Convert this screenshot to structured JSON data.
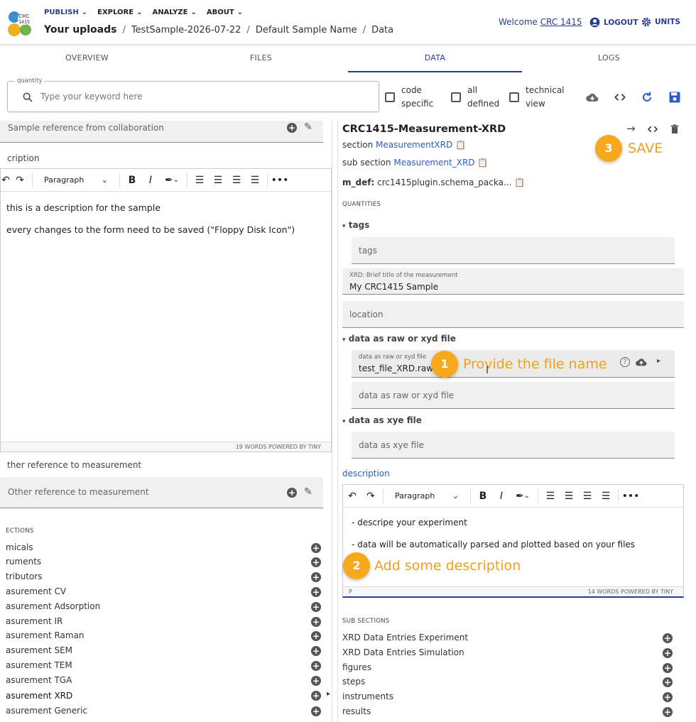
{
  "header": {
    "logo_text_top": "CRC",
    "logo_text_bottom": "1415",
    "nav": [
      "PUBLISH",
      "EXPLORE",
      "ANALYZE",
      "ABOUT"
    ],
    "breadcrumb_root": "Your uploads",
    "breadcrumb": [
      "TestSample-2026-07-22",
      "Default Sample Name",
      "Data"
    ],
    "welcome_prefix": "Welcome ",
    "welcome_user": "CRC 1415",
    "logout": "LOGOUT",
    "units": "UNITS"
  },
  "tabs": [
    "OVERVIEW",
    "FILES",
    "DATA",
    "LOGS"
  ],
  "search": {
    "label": "quantity",
    "placeholder": "Type your keyword here",
    "checkboxes": [
      {
        "line1": "code",
        "line2": "specific"
      },
      {
        "line1": "all",
        "line2": "defined"
      },
      {
        "line1": "technical",
        "line2": "view"
      }
    ]
  },
  "left": {
    "sample_ref_placeholder": "Sample reference from collaboration",
    "description_label": "cription",
    "editor": {
      "paragraph": "Paragraph",
      "lines": [
        "this is a description for the sample",
        "every changes to the form need to be saved (\"Floppy Disk Icon\")"
      ],
      "footer": "19 WORDS  POWERED BY TINY"
    },
    "other_ref_label": "ther reference to measurement",
    "other_ref_placeholder": "Other reference to measurement",
    "sections_title": "ECTIONS",
    "sections": [
      "micals",
      "ruments",
      "tributors",
      "asurement CV",
      "asurement Adsorption",
      "asurement IR",
      "asurement Raman",
      "asurement SEM",
      "asurement TEM",
      "asurement TGA",
      "asurement XRD",
      "asurement Generic"
    ]
  },
  "right": {
    "title": "CRC1415-Measurement-XRD",
    "section_label": "section",
    "section_value": "MeasurementXRD",
    "subsection_label": "sub section",
    "subsection_value": "Measurement_XRD",
    "mdef_label": "m_def:",
    "mdef_value": "crc1415plugin.schema_packa...",
    "quantities_title": "QUANTITIES",
    "tags_label": "tags",
    "tags_placeholder": "tags",
    "title_field_label": "XRD: Brief title of the measurement",
    "title_field_value": "My CRC1415 Sample",
    "location_placeholder": "location",
    "raw_group_label": "data as raw or xyd file",
    "raw_field_small": "data as raw or xyd file",
    "raw_field_value": "test_file_XRD.raw",
    "raw_field2_placeholder": "data as raw or xyd file",
    "xye_group_label": "data as xye file",
    "xye_placeholder": "data as xye file",
    "description_label": "description",
    "editor": {
      "paragraph": "Paragraph",
      "lines": [
        "- descripe your experiment",
        "- data will be automatically parsed and plotted based on your files"
      ],
      "footer_left": "P",
      "footer_right": "14 WORDS  POWERED BY TINY"
    },
    "subsections_title": "SUB SECTIONS",
    "subsections": [
      "XRD Data Entries Experiment",
      "XRD Data Entries Simulation",
      "figures",
      "steps",
      "instruments",
      "results"
    ]
  },
  "annotations": {
    "badge1": "1",
    "text1": "Provide the file name",
    "badge2": "2",
    "text2": "Add some description",
    "badge3": "3",
    "text3": "SAVE"
  },
  "colors": {
    "primary": "#2a3c8f",
    "link": "#2a5dc8",
    "annotation": "#f7a81c",
    "field_bg": "#f0f0f0"
  }
}
